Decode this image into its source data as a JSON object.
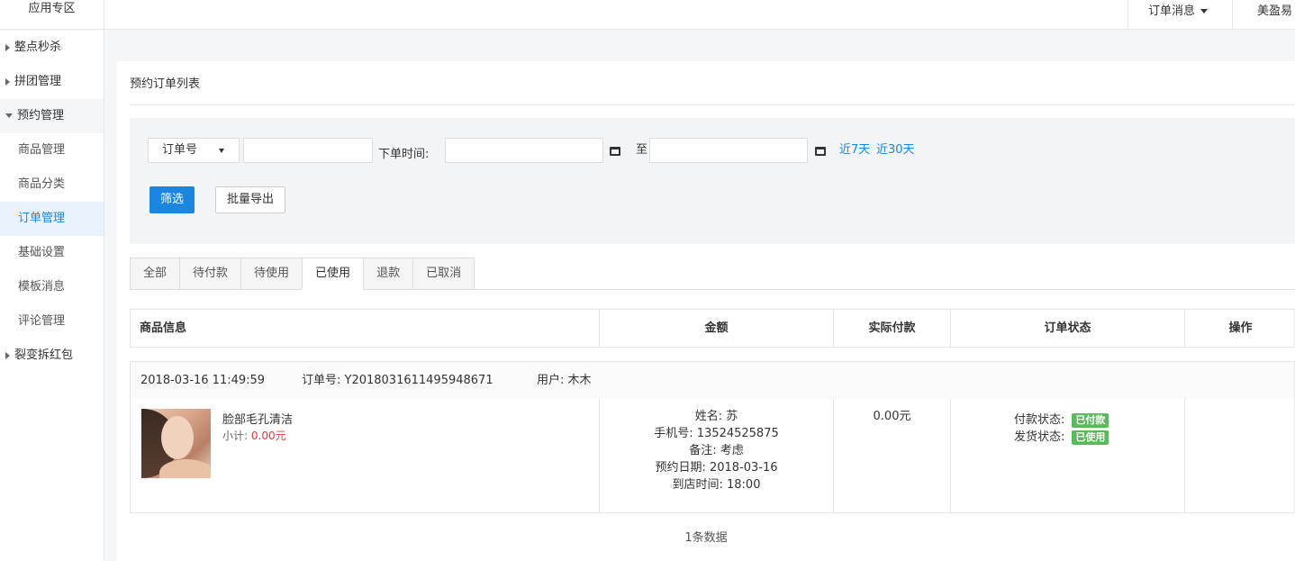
{
  "topbar": {
    "app_zone": "应用专区",
    "order_messages": "订单消息",
    "user_name": "美盈易"
  },
  "sidebar": {
    "items": [
      {
        "label": "整点秒杀",
        "type": "group",
        "expanded": false
      },
      {
        "label": "拼团管理",
        "type": "group",
        "expanded": false
      },
      {
        "label": "预约管理",
        "type": "group",
        "expanded": true
      },
      {
        "label": "商品管理",
        "type": "sub"
      },
      {
        "label": "商品分类",
        "type": "sub"
      },
      {
        "label": "订单管理",
        "type": "sub",
        "active": true
      },
      {
        "label": "基础设置",
        "type": "sub"
      },
      {
        "label": "模板消息",
        "type": "sub"
      },
      {
        "label": "评论管理",
        "type": "sub"
      },
      {
        "label": "裂变拆红包",
        "type": "group",
        "expanded": false
      }
    ]
  },
  "panel": {
    "title": "预约订单列表"
  },
  "filter": {
    "select_value": "订单号",
    "order_time_label": "下单时间:",
    "to_label": "至",
    "quick_7": "近7天",
    "quick_30": "近30天",
    "filter_button": "筛选",
    "export_button": "批量导出"
  },
  "tabs": [
    "全部",
    "待付款",
    "待使用",
    "已使用",
    "退款",
    "已取消"
  ],
  "active_tab": "已使用",
  "table": {
    "headers": {
      "product": "商品信息",
      "amount": "金额",
      "paid": "实际付款",
      "status": "订单状态",
      "action": "操作"
    }
  },
  "order": {
    "time": "2018-03-16 11:49:59",
    "order_no": "订单号: Y2018031611495948671",
    "user": "用户: 木木",
    "product_name": "脸部毛孔清洁",
    "subtotal_label": "小计:",
    "subtotal_value": "0.00元",
    "name": "姓名: 苏",
    "phone": "手机号: 13524525875",
    "remark": "备注: 考虑",
    "appointment_date": "预约日期: 2018-03-16",
    "arrival_time": "到店时间: 18:00",
    "paid_amount": "0.00元",
    "pay_status_label": "付款状态:",
    "pay_status": "已付款",
    "ship_status_label": "发货状态:",
    "ship_status": "已使用"
  },
  "count_text": "1条数据",
  "colors": {
    "primary": "#1a86e0",
    "success": "#5cb85c",
    "danger": "#e4393c"
  }
}
